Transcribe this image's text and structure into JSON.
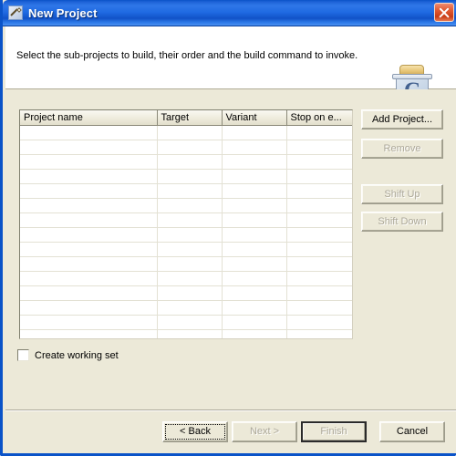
{
  "window": {
    "title": "New Project",
    "title_icon": "wizard-wand-icon",
    "close_label": "×",
    "accent_color": "#0a53c8",
    "face_color": "#ece9d8"
  },
  "header": {
    "description": "Select the sub-projects to build, their order and the build command to invoke.",
    "icon": "c-project-box-icon",
    "icon_letter": "C"
  },
  "table": {
    "columns": [
      {
        "label": "Project name"
      },
      {
        "label": "Target"
      },
      {
        "label": "Variant"
      },
      {
        "label": "Stop on e..."
      }
    ],
    "rows": [
      [
        "",
        "",
        "",
        ""
      ],
      [
        "",
        "",
        "",
        ""
      ],
      [
        "",
        "",
        "",
        ""
      ],
      [
        "",
        "",
        "",
        ""
      ],
      [
        "",
        "",
        "",
        ""
      ],
      [
        "",
        "",
        "",
        ""
      ],
      [
        "",
        "",
        "",
        ""
      ],
      [
        "",
        "",
        "",
        ""
      ],
      [
        "",
        "",
        "",
        ""
      ],
      [
        "",
        "",
        "",
        ""
      ],
      [
        "",
        "",
        "",
        ""
      ],
      [
        "",
        "",
        "",
        ""
      ],
      [
        "",
        "",
        "",
        ""
      ],
      [
        "",
        "",
        "",
        ""
      ],
      [
        "",
        "",
        "",
        ""
      ],
      [
        "",
        "",
        "",
        ""
      ]
    ]
  },
  "side_buttons": {
    "add_project": "Add Project...",
    "remove": "Remove",
    "shift_up": "Shift Up",
    "shift_down": "Shift Down"
  },
  "options": {
    "create_working_set_label": "Create working set",
    "create_working_set_checked": false
  },
  "footer": {
    "back": "< Back",
    "next": "Next >",
    "finish": "Finish",
    "cancel": "Cancel"
  }
}
